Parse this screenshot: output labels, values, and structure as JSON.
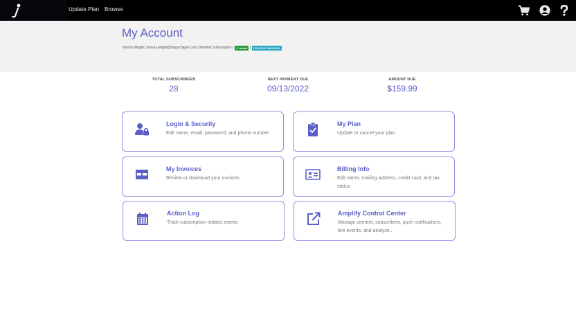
{
  "nav": {
    "update_plan": "Update Plan",
    "browse": "Browse"
  },
  "header": {
    "title": "My Account",
    "name": "Tammy Wright",
    "email": "tammy.wright@longschapel.com",
    "subscription": "Monthly Subscription",
    "active_badge": "✔ Active",
    "coupon_badge": "COUPON: WNC2022"
  },
  "stats": [
    {
      "label": "TOTAL SUBSCRIBERS",
      "value": "28"
    },
    {
      "label": "NEXT PAYMENT DUE",
      "value": "09/13/2022"
    },
    {
      "label": "AMOUNT DUE",
      "value": "$159.99"
    }
  ],
  "cards": [
    {
      "title": "Login & Security",
      "desc": "Edit name, email, password, and phone number",
      "icon": "user-lock-icon"
    },
    {
      "title": "My Plan",
      "desc": "Update or cancel your plan",
      "icon": "clipboard-check-icon"
    },
    {
      "title": "My Invoices",
      "desc": "Review or download your invoices",
      "icon": "invoice-table-icon"
    },
    {
      "title": "Billing Info",
      "desc": "Edit name, mailing address, credit card, and tax status",
      "icon": "id-card-icon"
    },
    {
      "title": "Action Log",
      "desc": "Track subscription related events",
      "icon": "calendar-icon"
    },
    {
      "title": "Amplify Control Center",
      "desc": "Manage content, subscribers, push notifications, live events, and analyze...",
      "icon": "external-link-icon"
    }
  ],
  "colors": {
    "accent": "#5a5ec8",
    "card_border": "#8e92e3",
    "active_badge": "#2a9a3a",
    "coupon_badge": "#27a8c7"
  }
}
